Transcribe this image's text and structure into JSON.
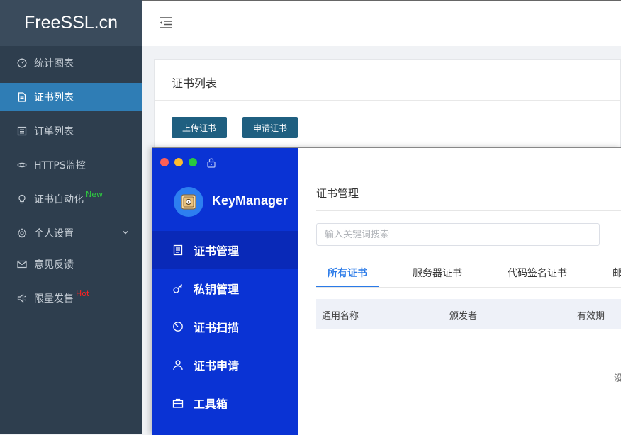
{
  "site": {
    "logo": "FreeSSL.cn"
  },
  "sidebar": {
    "items": [
      {
        "label": "统计图表",
        "icon": "dashboard-icon"
      },
      {
        "label": "证书列表",
        "icon": "document-icon",
        "active": true
      },
      {
        "label": "订单列表",
        "icon": "list-icon"
      },
      {
        "label": "HTTPS监控",
        "icon": "eye-icon"
      },
      {
        "label": "证书自动化",
        "icon": "bulb-icon",
        "badge": "New"
      },
      {
        "label": "个人设置",
        "icon": "gear-icon",
        "expandable": true
      },
      {
        "label": "意见反馈",
        "icon": "mail-icon"
      },
      {
        "label": "限量发售",
        "icon": "speaker-icon",
        "badge": "Hot"
      }
    ]
  },
  "topbar": {
    "menu_icon": "menu-fold-icon"
  },
  "panel": {
    "title": "证书列表",
    "upload_button": "上传证书",
    "apply_button": "申请证书"
  },
  "keymanager": {
    "app_name": "KeyManager",
    "colors": {
      "sidebar": "#0a33d4",
      "accent": "#2a7ae8"
    },
    "nav": [
      {
        "label": "证书管理",
        "icon": "certificate-icon",
        "active": true
      },
      {
        "label": "私钥管理",
        "icon": "key-icon"
      },
      {
        "label": "证书扫描",
        "icon": "scan-icon"
      },
      {
        "label": "证书申请",
        "icon": "user-icon"
      },
      {
        "label": "工具箱",
        "icon": "toolbox-icon"
      }
    ],
    "main": {
      "title": "证书管理",
      "search_placeholder": "输入关键词搜索",
      "tabs": [
        "所有证书",
        "服务器证书",
        "代码签名证书",
        "邮"
      ],
      "columns": [
        "通用名称",
        "颁发者",
        "有效期"
      ],
      "empty_text": "没"
    }
  }
}
